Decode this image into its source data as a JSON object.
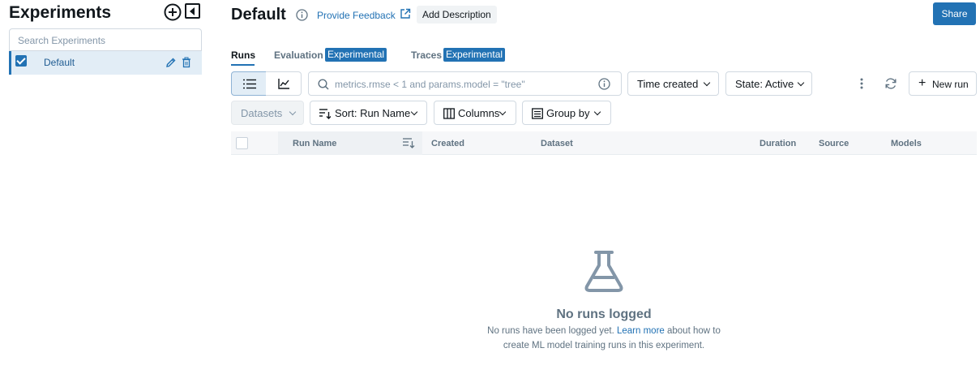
{
  "sidebar": {
    "title": "Experiments",
    "search_placeholder": "Search Experiments",
    "experiments": [
      {
        "label": "Default",
        "checked": true
      }
    ]
  },
  "header": {
    "title": "Default",
    "feedback_label": "Provide Feedback",
    "add_description_label": "Add Description",
    "share_label": "Share"
  },
  "tabs": [
    {
      "label": "Runs",
      "active": true
    },
    {
      "label": "Evaluation",
      "badge": "Experimental"
    },
    {
      "label": "Traces",
      "badge": "Experimental"
    }
  ],
  "toolbar": {
    "search_placeholder": "metrics.rmse < 1 and params.model = \"tree\"",
    "time_created_label": "Time created",
    "state_label": "State: Active",
    "new_run_label": "New run",
    "datasets_label": "Datasets",
    "sort_label": "Sort: Run Name",
    "columns_label": "Columns",
    "group_by_label": "Group by"
  },
  "table": {
    "columns": [
      "Run Name",
      "Created",
      "Dataset",
      "Duration",
      "Source",
      "Models"
    ]
  },
  "empty_state": {
    "title": "No runs logged",
    "line1_before": "No runs have been logged yet. ",
    "line1_link": "Learn more",
    "line1_after": " about how to",
    "line2": "create ML model training runs in this experiment."
  },
  "icons": {
    "add_experiment": "plus-circle-icon",
    "collapse": "sidebar-collapse-icon",
    "edit": "pencil-icon",
    "delete": "trash-icon",
    "info": "info-icon",
    "external": "external-link-icon",
    "list_view": "list-icon",
    "chart_view": "chart-icon",
    "search": "search-icon",
    "more": "kebab-icon",
    "refresh": "refresh-icon",
    "sort": "sort-icon",
    "columns": "columns-icon",
    "group": "group-icon",
    "empty": "flask-icon"
  },
  "colors": {
    "primary": "#2272b4",
    "selected_row": "#e2edf6",
    "muted_text": "#5f7281"
  }
}
